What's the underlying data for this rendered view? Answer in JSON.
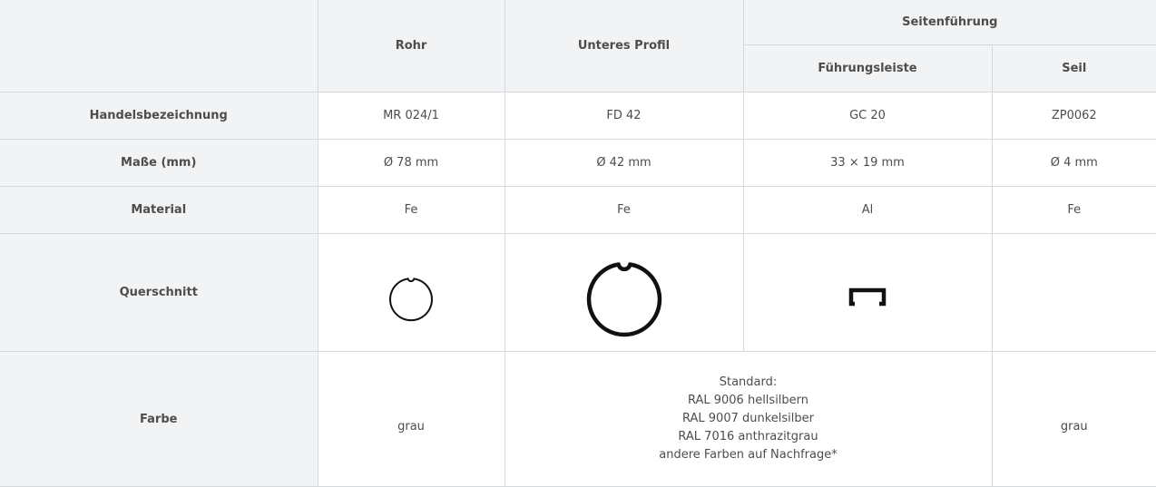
{
  "header": {
    "tube": "Rohr",
    "bottom_profile": "Unteres Profil",
    "side_guide": "Seitenführung",
    "guide_rail": "Führungsleiste",
    "cable": "Seil"
  },
  "rows": {
    "trade_name": {
      "label": "Handelsbezeichnung",
      "tube": "MR 024/1",
      "bottom_profile": "FD 42",
      "guide_rail": "GC 20",
      "cable": "ZP0062"
    },
    "dimensions": {
      "label": "Maße (mm)",
      "tube": "Ø 78 mm",
      "bottom_profile": "Ø 42 mm",
      "guide_rail": "33 × 19 mm",
      "cable": "Ø 4 mm"
    },
    "material": {
      "label": "Material",
      "tube": "Fe",
      "bottom_profile": "Fe",
      "guide_rail": "Al",
      "cable": "Fe"
    },
    "cross_section": {
      "label": "Querschnitt",
      "tube_icon": "tube-cross-section-icon",
      "bottom_profile_icon": "profile-cross-section-icon",
      "guide_rail_icon": "guide-rail-cross-section-icon"
    },
    "color": {
      "label": "Farbe",
      "tube": "grau",
      "standard_lines": [
        "Standard:",
        "RAL 9006 hellsilbern",
        "RAL 9007 dunkelsilber",
        "RAL 7016 anthrazitgrau",
        "andere Farben auf Nachfrage*"
      ],
      "cable": "grau"
    }
  },
  "colors": {
    "header_bg": "#f2f3f4",
    "border": "#d6d8db",
    "text": "#4d4d4d",
    "heading_text": "#222222"
  }
}
